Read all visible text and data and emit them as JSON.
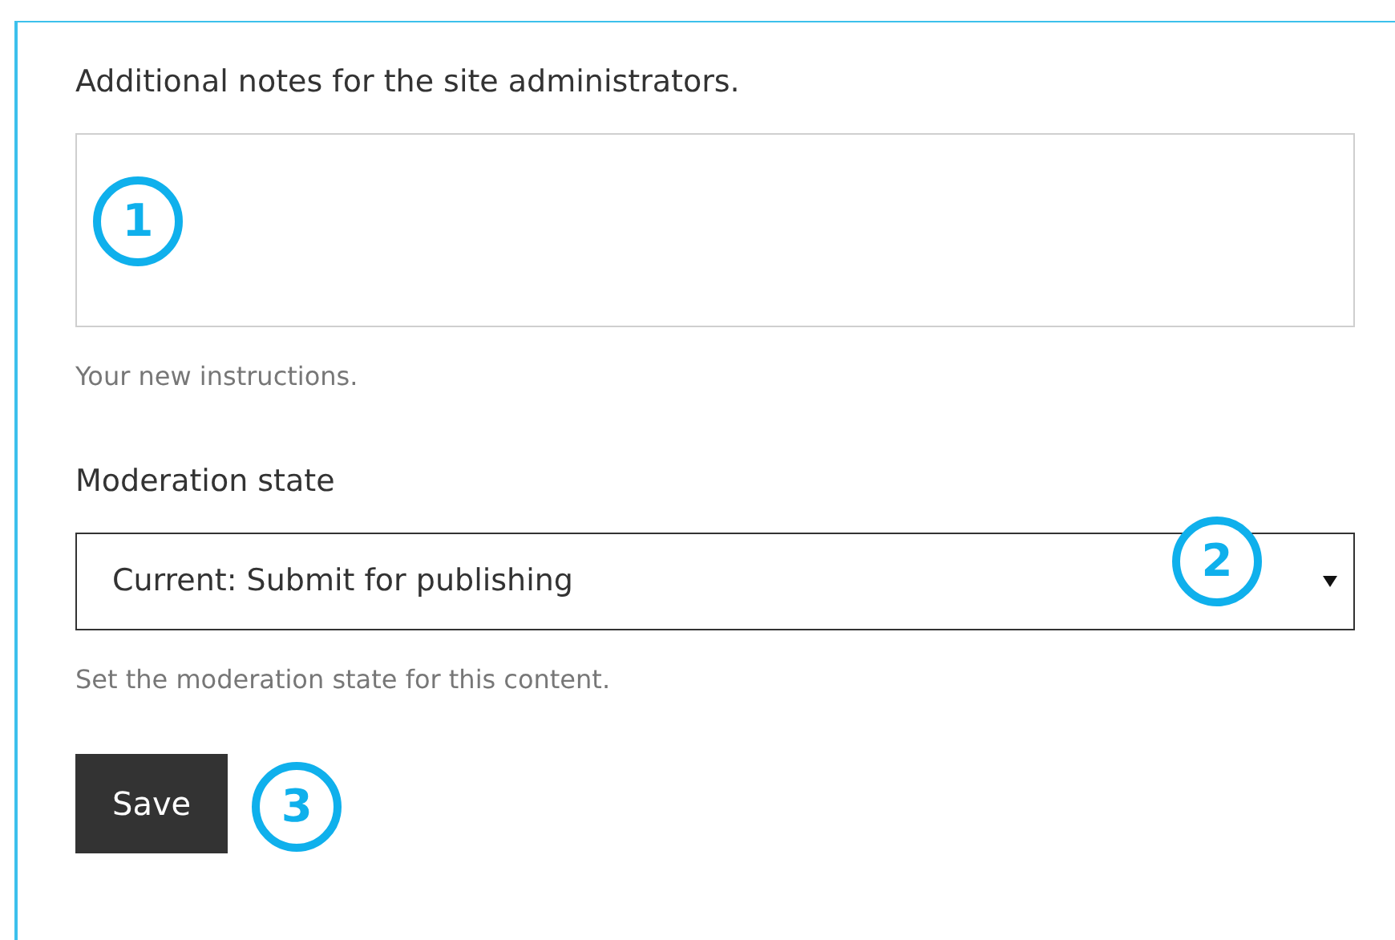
{
  "notes_field": {
    "label": "Additional notes for the site administrators.",
    "callout": "1",
    "help": "Your new instructions."
  },
  "moderation_state": {
    "label": "Moderation state",
    "value": "Current: Submit for publishing",
    "callout": "2",
    "help": "Set the moderation state for this content."
  },
  "save_button": {
    "label": "Save",
    "callout": "3"
  }
}
